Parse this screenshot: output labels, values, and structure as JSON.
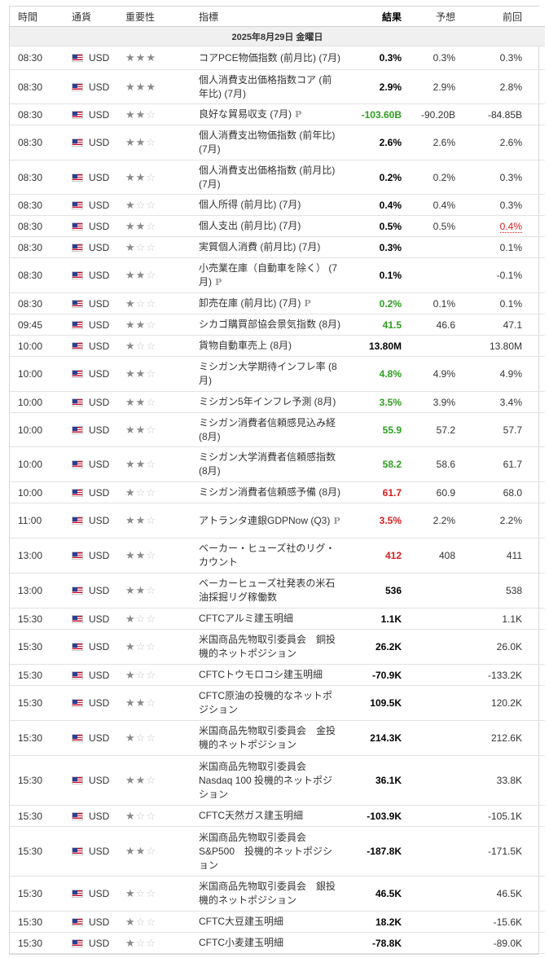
{
  "headers": {
    "time": "時間",
    "currency": "通貨",
    "importance": "重要性",
    "event": "指標",
    "actual": "結果",
    "forecast": "予想",
    "previous": "前回"
  },
  "date_label": "2025年8月29日 金曜日",
  "colors": {
    "positive": "#2d9f1e",
    "negative": "#d81e1e",
    "star_on": "#8a8a8a",
    "star_off": "#c8c8c8"
  },
  "rows": [
    {
      "time": "08:30",
      "currency": "USD",
      "importance": 3,
      "event": "コアPCE物価指数 (前月比) (7月)",
      "prelim": false,
      "actual": "0.3%",
      "actual_color": "",
      "forecast": "0.3%",
      "previous": "0.3%",
      "previous_color": "",
      "h": 29
    },
    {
      "time": "08:30",
      "currency": "USD",
      "importance": 3,
      "event": "個人消費支出価格指数コア (前年比) (7月)",
      "prelim": false,
      "actual": "2.9%",
      "actual_color": "",
      "forecast": "2.9%",
      "previous": "2.8%",
      "previous_color": "",
      "h": 42
    },
    {
      "time": "08:30",
      "currency": "USD",
      "importance": 2,
      "event": "良好な貿易収支 (7月)",
      "prelim": true,
      "actual": "-103.60B",
      "actual_color": "green",
      "forecast": "-90.20B",
      "previous": "-84.85B",
      "previous_color": "",
      "h": 26
    },
    {
      "time": "08:30",
      "currency": "USD",
      "importance": 2,
      "event": "個人消費支出物価指数 (前年比) (7月)",
      "prelim": false,
      "actual": "2.6%",
      "actual_color": "",
      "forecast": "2.6%",
      "previous": "2.6%",
      "previous_color": "",
      "h": 43
    },
    {
      "time": "08:30",
      "currency": "USD",
      "importance": 2,
      "event": "個人消費支出価格指数 (前月比) (7月)",
      "prelim": false,
      "actual": "0.2%",
      "actual_color": "",
      "forecast": "0.2%",
      "previous": "0.3%",
      "previous_color": "",
      "h": 42
    },
    {
      "time": "08:30",
      "currency": "USD",
      "importance": 1,
      "event": "個人所得 (前月比) (7月)",
      "prelim": false,
      "actual": "0.4%",
      "actual_color": "",
      "forecast": "0.4%",
      "previous": "0.3%",
      "previous_color": "",
      "h": 26
    },
    {
      "time": "08:30",
      "currency": "USD",
      "importance": 2,
      "event": "個人支出 (前月比) (7月)",
      "prelim": false,
      "actual": "0.5%",
      "actual_color": "",
      "forecast": "0.5%",
      "previous": "0.4%",
      "previous_color": "red",
      "h": 26
    },
    {
      "time": "08:30",
      "currency": "USD",
      "importance": 1,
      "event": "実質個人消費 (前月比) (7月)",
      "prelim": false,
      "actual": "0.3%",
      "actual_color": "",
      "forecast": "",
      "previous": "0.1%",
      "previous_color": "",
      "h": 26
    },
    {
      "time": "08:30",
      "currency": "USD",
      "importance": 2,
      "event": "小売業在庫（自動車を除く） (7月)",
      "prelim": true,
      "actual": "0.1%",
      "actual_color": "",
      "forecast": "",
      "previous": "-0.1%",
      "previous_color": "",
      "h": 43
    },
    {
      "time": "08:30",
      "currency": "USD",
      "importance": 1,
      "event": "卸売在庫 (前月比) (7月)",
      "prelim": true,
      "actual": "0.2%",
      "actual_color": "green",
      "forecast": "0.1%",
      "previous": "0.1%",
      "previous_color": "",
      "h": 26
    },
    {
      "time": "09:45",
      "currency": "USD",
      "importance": 2,
      "event": "シカゴ購買部協会景気指数 (8月)",
      "prelim": false,
      "actual": "41.5",
      "actual_color": "green",
      "forecast": "46.6",
      "previous": "47.1",
      "previous_color": "",
      "h": 26
    },
    {
      "time": "10:00",
      "currency": "USD",
      "importance": 1,
      "event": "貨物自動車売上 (8月)",
      "prelim": false,
      "actual": "13.80M",
      "actual_color": "",
      "forecast": "",
      "previous": "13.80M",
      "previous_color": "",
      "h": 26
    },
    {
      "time": "10:00",
      "currency": "USD",
      "importance": 2,
      "event": "ミシガン大学期待インフレ率 (8月)",
      "prelim": false,
      "actual": "4.8%",
      "actual_color": "green",
      "forecast": "4.9%",
      "previous": "4.9%",
      "previous_color": "",
      "h": 43
    },
    {
      "time": "10:00",
      "currency": "USD",
      "importance": 2,
      "event": "ミシガン5年インフレ予測 (8月)",
      "prelim": false,
      "actual": "3.5%",
      "actual_color": "green",
      "forecast": "3.9%",
      "previous": "3.4%",
      "previous_color": "",
      "h": 26
    },
    {
      "time": "10:00",
      "currency": "USD",
      "importance": 2,
      "event": "ミシガン消費者信頼感見込み経 (8月)",
      "prelim": false,
      "actual": "55.9",
      "actual_color": "green",
      "forecast": "57.2",
      "previous": "57.7",
      "previous_color": "",
      "h": 42
    },
    {
      "time": "10:00",
      "currency": "USD",
      "importance": 2,
      "event": "ミシガン大学消費者信頼感指数 (8月)",
      "prelim": false,
      "actual": "58.2",
      "actual_color": "green",
      "forecast": "58.6",
      "previous": "61.7",
      "previous_color": "",
      "h": 43
    },
    {
      "time": "10:00",
      "currency": "USD",
      "importance": 1,
      "event": "ミシガン消費者信頼感予備 (8月)",
      "prelim": false,
      "actual": "61.7",
      "actual_color": "red",
      "forecast": "60.9",
      "previous": "68.0",
      "previous_color": "",
      "h": 26
    },
    {
      "time": "11:00",
      "currency": "USD",
      "importance": 2,
      "event": "アトランタ連銀GDPNow (Q3)",
      "prelim": true,
      "actual": "3.5%",
      "actual_color": "red",
      "forecast": "2.2%",
      "previous": "2.2%",
      "previous_color": "",
      "h": 43
    },
    {
      "time": "13:00",
      "currency": "USD",
      "importance": 2,
      "event": "ベーカー・ヒューズ社のリグ・カウント",
      "prelim": false,
      "actual": "412",
      "actual_color": "red",
      "forecast": "408",
      "previous": "411",
      "previous_color": "",
      "h": 43
    },
    {
      "time": "13:00",
      "currency": "USD",
      "importance": 2,
      "event": "ベーカーヒューズ社発表の米石油採掘リグ稼働数",
      "prelim": false,
      "actual": "536",
      "actual_color": "",
      "forecast": "",
      "previous": "538",
      "previous_color": "",
      "h": 43
    },
    {
      "time": "15:30",
      "currency": "USD",
      "importance": 1,
      "event": "CFTCアルミ建玉明細",
      "prelim": false,
      "actual": "1.1K",
      "actual_color": "",
      "forecast": "",
      "previous": "1.1K",
      "previous_color": "",
      "h": 26
    },
    {
      "time": "15:30",
      "currency": "USD",
      "importance": 1,
      "event": "米国商品先物取引委員会　銅投機的ネットポジション",
      "prelim": false,
      "actual": "26.2K",
      "actual_color": "",
      "forecast": "",
      "previous": "26.0K",
      "previous_color": "",
      "h": 43
    },
    {
      "time": "15:30",
      "currency": "USD",
      "importance": 1,
      "event": "CFTCトウモロコシ建玉明細",
      "prelim": false,
      "actual": "-70.9K",
      "actual_color": "",
      "forecast": "",
      "previous": "-133.2K",
      "previous_color": "",
      "h": 26
    },
    {
      "time": "15:30",
      "currency": "USD",
      "importance": 2,
      "event": "CFTC原油の投機的なネットポジション",
      "prelim": false,
      "actual": "109.5K",
      "actual_color": "",
      "forecast": "",
      "previous": "120.2K",
      "previous_color": "",
      "h": 43
    },
    {
      "time": "15:30",
      "currency": "USD",
      "importance": 1,
      "event": "米国商品先物取引委員会　金投機的ネットポジション",
      "prelim": false,
      "actual": "214.3K",
      "actual_color": "",
      "forecast": "",
      "previous": "212.6K",
      "previous_color": "",
      "h": 43
    },
    {
      "time": "15:30",
      "currency": "USD",
      "importance": 2,
      "event": "米国商品先物取引委員会 Nasdaq 100 投機的ネットポジション",
      "prelim": false,
      "actual": "36.1K",
      "actual_color": "",
      "forecast": "",
      "previous": "33.8K",
      "previous_color": "",
      "h": 61
    },
    {
      "time": "15:30",
      "currency": "USD",
      "importance": 1,
      "event": "CFTC天然ガス建玉明細",
      "prelim": false,
      "actual": "-103.9K",
      "actual_color": "",
      "forecast": "",
      "previous": "-105.1K",
      "previous_color": "",
      "h": 26
    },
    {
      "time": "15:30",
      "currency": "USD",
      "importance": 2,
      "event": "米国商品先物取引委員会 S&P500　投機的ネットポジション",
      "prelim": false,
      "actual": "-187.8K",
      "actual_color": "",
      "forecast": "",
      "previous": "-171.5K",
      "previous_color": "",
      "h": 61
    },
    {
      "time": "15:30",
      "currency": "USD",
      "importance": 1,
      "event": "米国商品先物取引委員会　銀投機的ネットポジション",
      "prelim": false,
      "actual": "46.5K",
      "actual_color": "",
      "forecast": "",
      "previous": "46.5K",
      "previous_color": "",
      "h": 43
    },
    {
      "time": "15:30",
      "currency": "USD",
      "importance": 1,
      "event": "CFTC大豆建玉明細",
      "prelim": false,
      "actual": "18.2K",
      "actual_color": "",
      "forecast": "",
      "previous": "-15.6K",
      "previous_color": "",
      "h": 26
    },
    {
      "time": "15:30",
      "currency": "USD",
      "importance": 1,
      "event": "CFTC小麦建玉明細",
      "prelim": false,
      "actual": "-78.8K",
      "actual_color": "",
      "forecast": "",
      "previous": "-89.0K",
      "previous_color": "",
      "h": 26
    }
  ]
}
